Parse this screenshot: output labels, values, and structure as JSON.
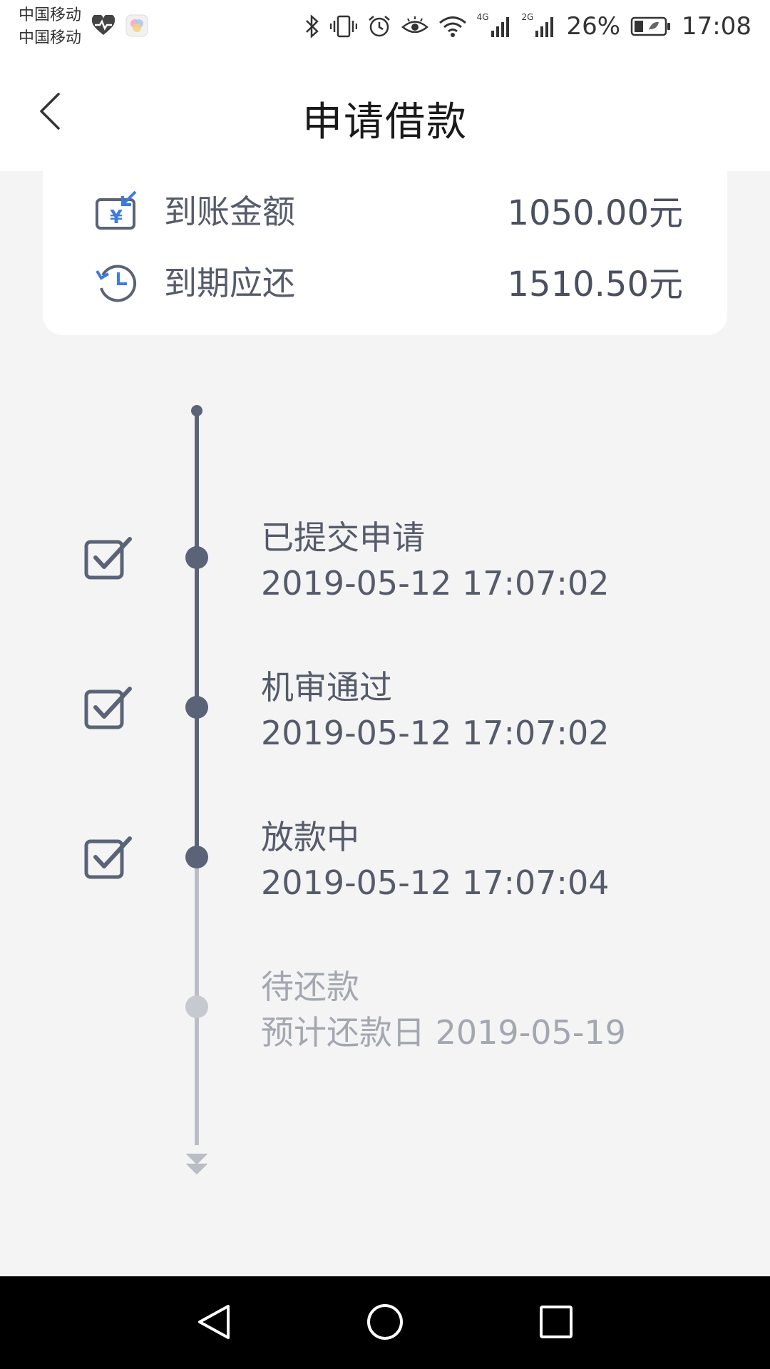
{
  "status_bar": {
    "carrier_1": "中国移动",
    "carrier_2": "中国移动",
    "network_1": "4G",
    "network_2": "2G",
    "battery": "26%",
    "time": "17:08",
    "icons": [
      "health-heart-icon",
      "gallery-app-icon",
      "bluetooth-icon",
      "vibrate-icon",
      "alarm-icon",
      "eye-comfort-icon",
      "wifi-icon",
      "signal-icon",
      "battery-icon"
    ]
  },
  "nav": {
    "back_icon": "chevron-left-icon",
    "title": "申请借款"
  },
  "summary": {
    "rows": [
      {
        "icon": "yuan-transfer-icon",
        "label": "到账金额",
        "value": "1050.00元"
      },
      {
        "icon": "clock-history-icon",
        "label": "到期应还",
        "value": "1510.50元"
      }
    ]
  },
  "timeline": {
    "steps": [
      {
        "title": "已提交申请",
        "time": "2019-05-12 17:07:02",
        "status": "done"
      },
      {
        "title": "机审通过",
        "time": "2019-05-12 17:07:02",
        "status": "done"
      },
      {
        "title": "放款中",
        "time": "2019-05-12 17:07:04",
        "status": "done"
      },
      {
        "title": "待还款",
        "time": "预计还款日 2019-05-19",
        "status": "pending"
      }
    ]
  },
  "system_nav": {
    "buttons": [
      "nav-back-triangle-icon",
      "nav-home-circle-icon",
      "nav-recents-square-icon"
    ]
  },
  "colors": {
    "accent_dark": "#5b6378",
    "accent_light": "#b9bdc6",
    "icon_blue": "#3d7be0",
    "background": "#f4f4f4"
  }
}
